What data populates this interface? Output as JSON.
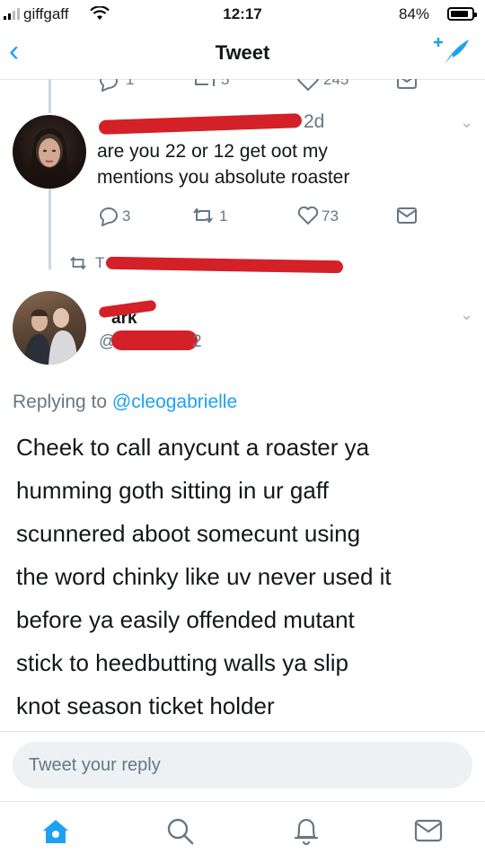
{
  "status_bar": {
    "carrier": "giffgaff",
    "time": "12:17",
    "battery": "84%"
  },
  "nav": {
    "back_label": "‹",
    "title": "Tweet"
  },
  "prev_tweet_stats": {
    "reply": "1",
    "retweet": "5",
    "like": "245"
  },
  "tweet1": {
    "handle_partial": "2d",
    "text_line1": "are you 22 or 12 get oot my",
    "text_line2": "mentions you absolute roaster",
    "replies": "3",
    "retweets": "1",
    "likes": "73"
  },
  "retweet_notice": {
    "prefix": "T"
  },
  "tweet2": {
    "name_visible": "ark",
    "handle_prefix": "@",
    "handle_suffix": "2",
    "replying_prefix": "Replying to ",
    "replying_handle": "@cleogabrielle",
    "lines": [
      "Cheek to call anycunt a roaster ya",
      "humming goth sitting in ur gaff",
      "scunnered aboot somecunt using",
      "the word chinky like uv never used it",
      "before ya easily offended mutant",
      "stick to heedbutting walls ya slip",
      "knot season ticket holder"
    ]
  },
  "reply_input": {
    "placeholder": "Tweet your reply"
  },
  "colors": {
    "accent": "#1da1f2",
    "redaction": "#d42027",
    "muted": "#657786"
  },
  "tabbar": {
    "icons": [
      "home-icon",
      "search-icon",
      "notifications-icon",
      "messages-icon"
    ]
  }
}
